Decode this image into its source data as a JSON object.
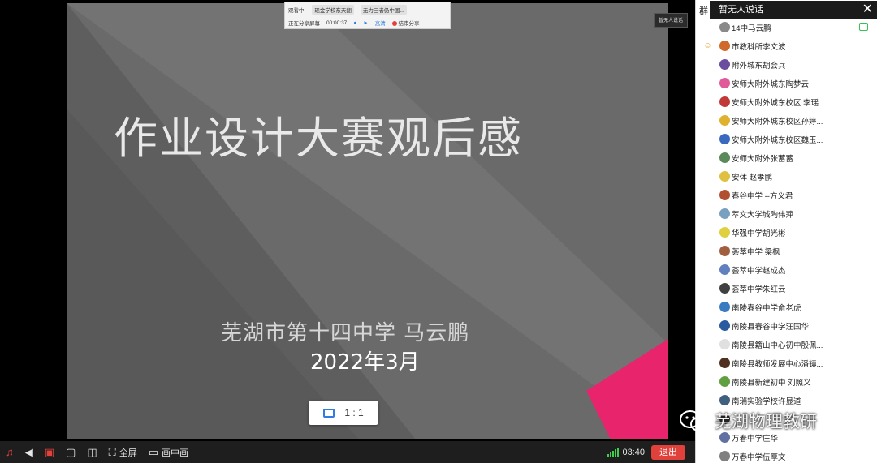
{
  "slide": {
    "title": "作业设计大赛观后感",
    "author": "芜湖市第十四中学      马云鹏",
    "date": "2022年3月",
    "ratio_label": "1 : 1",
    "colors": {
      "background": "#5e5e5e",
      "accent_triangle": "#e8246c"
    }
  },
  "share_bar": {
    "row1": [
      "观看中:",
      "现金学校东天翻",
      "无力三者仍中国..."
    ],
    "sharing_label": "正在分享屏幕",
    "elapsed": "00:00:37",
    "stream_label": "高清",
    "end_label": "结束分享"
  },
  "top_badge": "暂无人说话",
  "toolbar": {
    "fullscreen_label": "全屏",
    "pip_label": "画中画",
    "time": "03:40",
    "exit_label": "退出"
  },
  "panel": {
    "edge_label": "群",
    "tooltip": "暂无人说话",
    "users": [
      "14中马云鹏",
      "市教科所李文波",
      "附外城东胡会兵",
      "安师大附外城东陶梦云",
      "安师大附外城东校区 李瑶...",
      "安师大附外城东校区孙婷...",
      "安师大附外城东校区魏玉...",
      "安师大附外张蓄蓄",
      "安体  赵孝鹏",
      "春谷中学 --方义君",
      "萃文大学城陶伟萍",
      "华强中学胡光彬",
      "荟萃中学 梁枫",
      "荟萃中学赵成杰",
      "荟萃中学朱红云",
      "南陵春谷中学俞老虎",
      "南陵县春谷中学汪国华",
      "南陵县籍山中心初中殷佩...",
      "南陵县教师发展中心潘镇...",
      "南陵县新建初中 刘照义",
      "南瑞实验学校许显道",
      "",
      "万春中学庄华",
      "万春中学伍厚文"
    ]
  },
  "watermark": "芜湖物理教研"
}
